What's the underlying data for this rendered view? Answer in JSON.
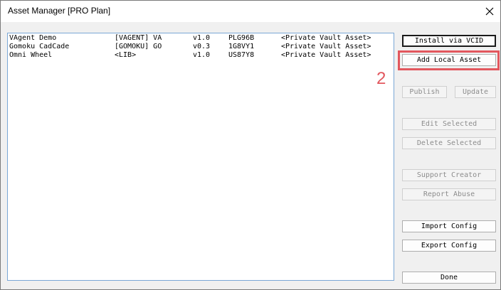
{
  "window": {
    "title": "Asset Manager [PRO Plan]",
    "close_icon": "close-icon"
  },
  "assets": [
    {
      "name": "VAgent Demo",
      "tag": "[VAGENT] VA",
      "version": "v1.0",
      "vcid": "PLG96B",
      "source": "<Private Vault Asset>"
    },
    {
      "name": "Gomoku CadCade",
      "tag": "[GOMOKU] GO",
      "version": "v0.3",
      "vcid": "1G8VY1",
      "source": "<Private Vault Asset>"
    },
    {
      "name": "Omni Wheel",
      "tag": "<LIB>",
      "version": "v1.0",
      "vcid": "US87Y8",
      "source": "<Private Vault Asset>"
    }
  ],
  "buttons": {
    "install_vcid": "Install via VCID",
    "add_local": "Add Local Asset",
    "publish": "Publish",
    "update": "Update",
    "edit_selected": "Edit Selected",
    "delete_selected": "Delete Selected",
    "support_creator": "Support Creator",
    "report_abuse": "Report Abuse",
    "import_config": "Import Config",
    "export_config": "Export Config",
    "done": "Done"
  },
  "annotation": {
    "step_number": "2",
    "color": "#e2575e"
  }
}
